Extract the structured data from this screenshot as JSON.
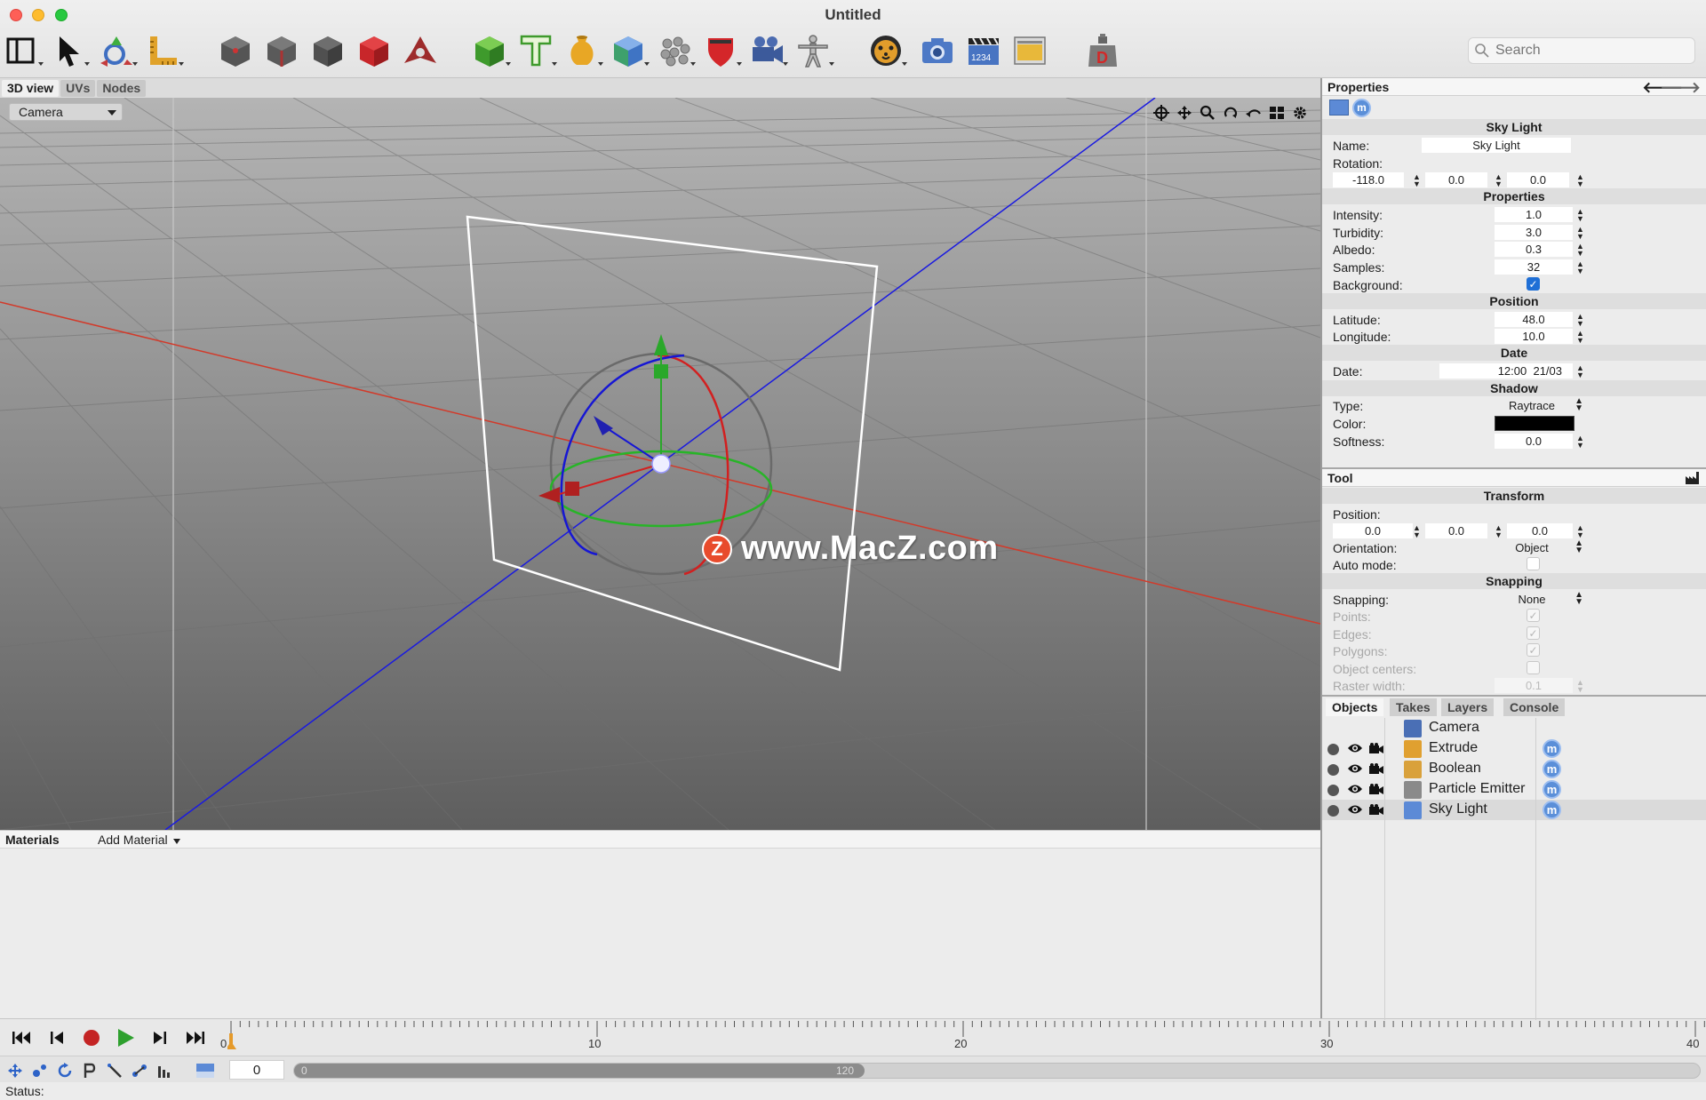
{
  "window": {
    "title": "Untitled"
  },
  "toolbar": {
    "icons": [
      "layout-icon",
      "select-arrow-icon",
      "move-gizmo-icon",
      "measure-ruler-icon",
      "dark-cube-1-icon",
      "dark-cube-2-icon",
      "dark-cube-3-icon",
      "red-cube-icon",
      "vertex-tool-icon",
      "green-cube-icon",
      "text-icon",
      "vase-icon",
      "blue-gem-icon",
      "spheres-grid-icon",
      "shield-icon",
      "movie-camera-icon",
      "figure-icon",
      "cheetah-icon",
      "photo-camera-icon",
      "clapperboard-icon",
      "folder-image-icon",
      "weight-icon"
    ],
    "search_placeholder": "Search"
  },
  "view_tabs": [
    "3D view",
    "UVs",
    "Nodes"
  ],
  "viewport": {
    "camera_select": "Camera",
    "watermark": "www.MacZ.com",
    "nav_tools": [
      "target-icon",
      "pan-icon",
      "zoom-icon",
      "orbit-icon",
      "undo-view-icon",
      "layout-grid-icon",
      "settings-gear-icon"
    ]
  },
  "materials": {
    "title": "Materials",
    "add_label": "Add Material"
  },
  "properties": {
    "header": "Properties",
    "object_title": "Sky Light",
    "name_label": "Name:",
    "name_value": "Sky Light",
    "rotation_label": "Rotation:",
    "rotation": [
      "-118.0",
      "0.0",
      "0.0"
    ],
    "sec_properties": "Properties",
    "intensity_label": "Intensity:",
    "intensity": "1.0",
    "turbidity_label": "Turbidity:",
    "turbidity": "3.0",
    "albedo_label": "Albedo:",
    "albedo": "0.3",
    "samples_label": "Samples:",
    "samples": "32",
    "background_label": "Background:",
    "background_checked": true,
    "sec_position": "Position",
    "latitude_label": "Latitude:",
    "latitude": "48.0",
    "longitude_label": "Longitude:",
    "longitude": "10.0",
    "sec_date": "Date",
    "date_label": "Date:",
    "date_value": "12:00  21/03",
    "sec_shadow": "Shadow",
    "type_label": "Type:",
    "type_value": "Raytrace",
    "color_label": "Color:",
    "color_value": "#000000",
    "softness_label": "Softness:",
    "softness": "0.0"
  },
  "tool": {
    "header": "Tool",
    "sec_transform": "Transform",
    "position_label": "Position:",
    "position": [
      "0.0",
      "0.0",
      "0.0"
    ],
    "orientation_label": "Orientation:",
    "orientation": "Object",
    "auto_mode_label": "Auto mode:",
    "sec_snapping": "Snapping",
    "snapping_label": "Snapping:",
    "snapping": "None",
    "points_label": "Points:",
    "edges_label": "Edges:",
    "polygons_label": "Polygons:",
    "object_centers_label": "Object centers:",
    "raster_width_label": "Raster width:",
    "raster_width": "0.1"
  },
  "objects": {
    "tabs": [
      "Objects",
      "Takes",
      "Layers",
      "Console"
    ],
    "items": [
      {
        "name": "Camera",
        "icon_color": "#4a6fb5",
        "has_controls": false
      },
      {
        "name": "Extrude",
        "icon_color": "#e0a030",
        "has_controls": true
      },
      {
        "name": "Boolean",
        "icon_color": "#d9a13b",
        "has_controls": true
      },
      {
        "name": "Particle Emitter",
        "icon_color": "#8a8a8a",
        "has_controls": true
      },
      {
        "name": "Sky Light",
        "icon_color": "#5c8ad6",
        "has_controls": true
      }
    ],
    "material_badge": "m"
  },
  "timeline": {
    "labels": [
      "0",
      "10",
      "20",
      "30",
      "40"
    ],
    "frame": "0",
    "range_start": "0",
    "range_end": "120"
  },
  "status": {
    "label": "Status:"
  }
}
